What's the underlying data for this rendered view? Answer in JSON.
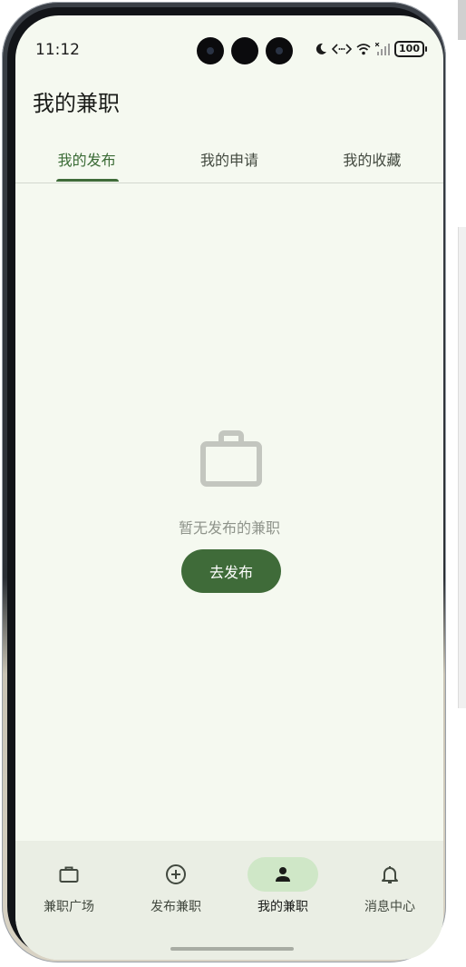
{
  "status_bar": {
    "time": "11:12",
    "battery": "100",
    "icons": [
      "moon-icon",
      "data-transfer-icon",
      "wifi-icon",
      "signal-icon",
      "battery-icon"
    ]
  },
  "header": {
    "title": "我的兼职"
  },
  "tabs": [
    {
      "label": "我的发布",
      "active": true
    },
    {
      "label": "我的申请",
      "active": false
    },
    {
      "label": "我的收藏",
      "active": false
    }
  ],
  "empty_state": {
    "icon": "briefcase-icon",
    "message": "暂无发布的兼职",
    "action_label": "去发布"
  },
  "bottom_nav": [
    {
      "label": "兼职广场",
      "icon": "briefcase-icon",
      "active": false
    },
    {
      "label": "发布兼职",
      "icon": "add-circle-icon",
      "active": false
    },
    {
      "label": "我的兼职",
      "icon": "person-icon",
      "active": true
    },
    {
      "label": "消息中心",
      "icon": "bell-icon",
      "active": false
    }
  ],
  "colors": {
    "background": "#f5f9f0",
    "primary": "#3f6b39",
    "nav_background": "#eaeee4",
    "nav_active_pill": "#cfe7c7"
  }
}
